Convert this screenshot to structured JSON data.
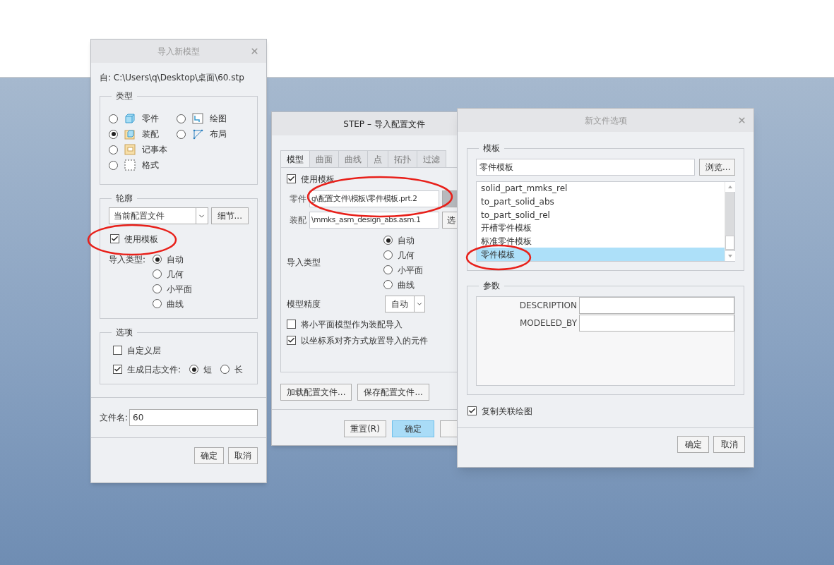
{
  "import_dialog": {
    "title": "导入新模型",
    "active": false,
    "source": "自: C:\\Users\\q\\Desktop\\桌面\\60.stp",
    "type_group": {
      "label": "类型",
      "rows": [
        [
          {
            "label": "零件",
            "kind": "part",
            "selected": false
          },
          {
            "label": "绘图",
            "kind": "drawing",
            "selected": false
          }
        ],
        [
          {
            "label": "装配",
            "kind": "assembly",
            "selected": true
          },
          {
            "label": "布局",
            "kind": "layout",
            "selected": false
          }
        ],
        [
          {
            "label": "记事本",
            "kind": "notebook",
            "selected": false
          }
        ],
        [
          {
            "label": "格式",
            "kind": "format",
            "selected": false
          }
        ]
      ]
    },
    "profile_group": {
      "label": "轮廓",
      "dropdown": "当前配置文件",
      "details_button": "细节...",
      "use_template": {
        "label": "使用模板",
        "checked": true
      },
      "import_type": {
        "label": "导入类型:",
        "options": [
          {
            "label": "自动",
            "selected": true
          },
          {
            "label": "几何",
            "selected": false
          },
          {
            "label": "小平面",
            "selected": false
          },
          {
            "label": "曲线",
            "selected": false
          }
        ]
      }
    },
    "options_group": {
      "label": "选项",
      "custom_layers": {
        "label": "自定义层",
        "checked": false
      },
      "log_file": {
        "label": "生成日志文件:",
        "checked": true,
        "options": [
          {
            "label": "短",
            "selected": true
          },
          {
            "label": "长",
            "selected": false
          }
        ]
      }
    },
    "filename": {
      "label": "文件名:",
      "value": "60"
    },
    "buttons": [
      "确定",
      "取消"
    ]
  },
  "step_dialog": {
    "title": "STEP – 导入配置文件",
    "active": true,
    "tabs": [
      {
        "label": "模型",
        "selected": true
      },
      {
        "label": "曲面",
        "selected": false
      },
      {
        "label": "曲线",
        "selected": false
      },
      {
        "label": "点",
        "selected": false
      },
      {
        "label": "拓扑",
        "selected": false
      },
      {
        "label": "过滤",
        "selected": false
      }
    ],
    "use_template": {
      "label": "使用模板",
      "checked": true
    },
    "template_fields": [
      {
        "label": "零件",
        "value": "g\\配置文件\\模板\\零件模板.prt.2",
        "pressed": true
      },
      {
        "label": "装配",
        "value": "\\mmks_asm_design_abs.asm.1",
        "button": "选",
        "pressed": false
      }
    ],
    "import_type": {
      "label": "导入类型",
      "options": [
        {
          "label": "自动",
          "selected": true
        },
        {
          "label": "几何",
          "selected": false
        },
        {
          "label": "小平面",
          "selected": false
        },
        {
          "label": "曲线",
          "selected": false
        }
      ]
    },
    "precision": {
      "label": "模型精度",
      "value": "自动"
    },
    "checkboxes": [
      {
        "label": "将小平面模型作为装配导入",
        "checked": false
      },
      {
        "label": "以坐标系对齐方式放置导入的元件",
        "checked": true
      }
    ],
    "file_buttons": [
      "加载配置文件...",
      "保存配置文件..."
    ],
    "buttons": [
      {
        "label": "重置(R)",
        "primary": false
      },
      {
        "label": "确定",
        "primary": true
      }
    ]
  },
  "new_file_dialog": {
    "title": "新文件选项",
    "active": false,
    "template_group": {
      "label": "模板",
      "value": "零件模板",
      "browse_button": "浏览...",
      "items": [
        {
          "label": "solid_part_mmks_rel",
          "selected": false
        },
        {
          "label": "to_part_solid_abs",
          "selected": false
        },
        {
          "label": "to_part_solid_rel",
          "selected": false
        },
        {
          "label": "开槽零件模板",
          "selected": false
        },
        {
          "label": "标准零件模板",
          "selected": false
        },
        {
          "label": "零件模板",
          "selected": true
        }
      ]
    },
    "params_group": {
      "label": "参数",
      "params": [
        {
          "name": "DESCRIPTION"
        },
        {
          "name": "MODELED_BY"
        }
      ]
    },
    "copy_drawing": {
      "label": "复制关联绘图",
      "checked": true
    },
    "buttons": [
      "确定",
      "取消"
    ]
  }
}
